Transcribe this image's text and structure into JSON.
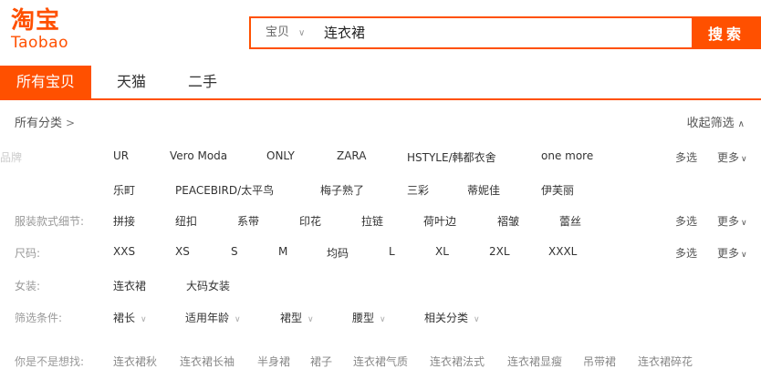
{
  "logo": {
    "cn": "淘宝",
    "en": "Taobao"
  },
  "search": {
    "scope": "宝贝",
    "query": "连衣裙",
    "button": "搜索"
  },
  "tabs": [
    "所有宝贝",
    "天猫",
    "二手"
  ],
  "breadcrumb": {
    "label": "所有分类",
    "collapse": "收起筛选"
  },
  "filters": {
    "multi_label": "多选",
    "more_label": "更多",
    "brand": {
      "label": "品牌",
      "row1": [
        "UR",
        "Vero Moda",
        "ONLY",
        "ZARA",
        "HSTYLE/韩都衣舍",
        "one more"
      ],
      "row2": [
        "乐町",
        "PEACEBIRD/太平鸟",
        "梅子熟了",
        "三彩",
        "蒂妮佳",
        "伊芙丽"
      ]
    },
    "details": {
      "label": "服装款式细节:",
      "items": [
        "拼接",
        "纽扣",
        "系带",
        "印花",
        "拉链",
        "荷叶边",
        "褶皱",
        "蕾丝"
      ]
    },
    "size": {
      "label": "尺码:",
      "items": [
        "XXS",
        "XS",
        "S",
        "M",
        "均码",
        "L",
        "XL",
        "2XL",
        "XXXL"
      ]
    },
    "women": {
      "label": "女装:",
      "items": [
        "连衣裙",
        "大码女装"
      ]
    },
    "conditions": {
      "label": "筛选条件:",
      "items": [
        "裙长",
        "适用年龄",
        "裙型",
        "腰型",
        "相关分类"
      ]
    }
  },
  "suggest": {
    "label": "你是不是想找:",
    "items": [
      "连衣裙秋",
      "连衣裙长袖",
      "半身裙",
      "裙子",
      "连衣裙气质",
      "连衣裙法式",
      "连衣裙显瘦",
      "吊带裙",
      "连衣裙碎花"
    ]
  },
  "colors": {
    "accent": "#ff5000"
  },
  "icons": {
    "dropdown": "chevron-down-icon",
    "breadcrumb": "chevron-right-icon"
  }
}
